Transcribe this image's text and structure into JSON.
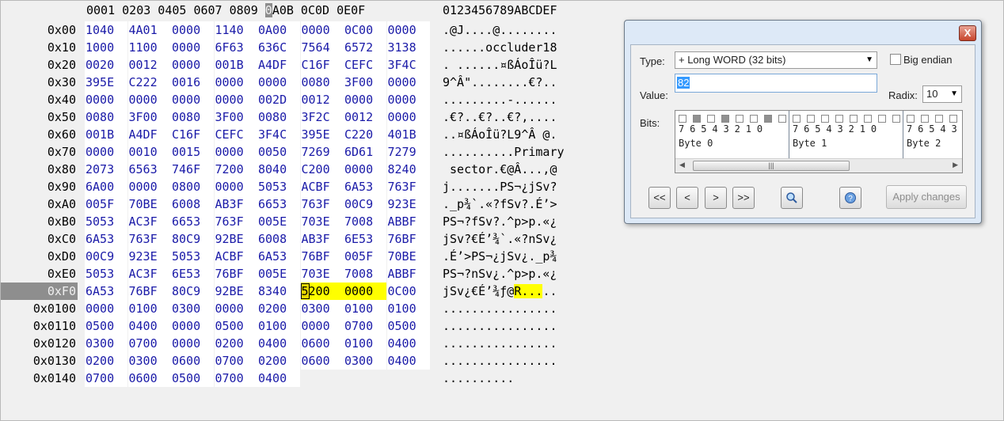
{
  "hex_header": {
    "columns_before": "0001 0203 0405 0607 0809 ",
    "col_highlight_char": "0",
    "columns_after": "A0B 0C0D 0E0F",
    "ascii_header": "0123456789ABCDEF"
  },
  "rows": [
    {
      "offset": "0x00",
      "hex": [
        "1040",
        "4A01",
        "0000",
        "1140",
        "0A00",
        "0000",
        "0C00",
        "0000"
      ],
      "ascii": ".@J....@........"
    },
    {
      "offset": "0x10",
      "hex": [
        "1000",
        "1100",
        "0000",
        "6F63",
        "636C",
        "7564",
        "6572",
        "3138"
      ],
      "ascii": "......occluder18"
    },
    {
      "offset": "0x20",
      "hex": [
        "0020",
        "0012",
        "0000",
        "001B",
        "A4DF",
        "C16F",
        "CEFC",
        "3F4C"
      ],
      "ascii": ". ......¤ßÁoÎü?L"
    },
    {
      "offset": "0x30",
      "hex": [
        "395E",
        "C222",
        "0016",
        "0000",
        "0000",
        "0080",
        "3F00",
        "0000"
      ],
      "ascii": "9^Â\"........€?.."
    },
    {
      "offset": "0x40",
      "hex": [
        "0000",
        "0000",
        "0000",
        "0000",
        "002D",
        "0012",
        "0000",
        "0000"
      ],
      "ascii": ".........-......"
    },
    {
      "offset": "0x50",
      "hex": [
        "0080",
        "3F00",
        "0080",
        "3F00",
        "0080",
        "3F2C",
        "0012",
        "0000"
      ],
      "ascii": ".€?..€?..€?,...."
    },
    {
      "offset": "0x60",
      "hex": [
        "001B",
        "A4DF",
        "C16F",
        "CEFC",
        "3F4C",
        "395E",
        "C220",
        "401B"
      ],
      "ascii": "..¤ßÁoÎü?L9^Â @."
    },
    {
      "offset": "0x70",
      "hex": [
        "0000",
        "0010",
        "0015",
        "0000",
        "0050",
        "7269",
        "6D61",
        "7279"
      ],
      "ascii": "..........Primary"
    },
    {
      "offset": "0x80",
      "hex": [
        "2073",
        "6563",
        "746F",
        "7200",
        "8040",
        "C200",
        "0000",
        "8240"
      ],
      "ascii": " sector.€@Â...‚@"
    },
    {
      "offset": "0x90",
      "hex": [
        "6A00",
        "0000",
        "0800",
        "0000",
        "5053",
        "ACBF",
        "6A53",
        "763F"
      ],
      "ascii": "j.......PS¬¿jSv?"
    },
    {
      "offset": "0xA0",
      "hex": [
        "005F",
        "70BE",
        "6008",
        "AB3F",
        "6653",
        "763F",
        "00C9",
        "923E"
      ],
      "ascii": "._p¾`.«?fSv?.É’>"
    },
    {
      "offset": "0xB0",
      "hex": [
        "5053",
        "AC3F",
        "6653",
        "763F",
        "005E",
        "703E",
        "7008",
        "ABBF"
      ],
      "ascii": "PS¬?fSv?.^p>p.«¿"
    },
    {
      "offset": "0xC0",
      "hex": [
        "6A53",
        "763F",
        "80C9",
        "92BE",
        "6008",
        "AB3F",
        "6E53",
        "76BF"
      ],
      "ascii": "jSv?€É’¾`.«?nSv¿"
    },
    {
      "offset": "0xD0",
      "hex": [
        "00C9",
        "923E",
        "5053",
        "ACBF",
        "6A53",
        "76BF",
        "005F",
        "70BE"
      ],
      "ascii": ".É’>PS¬¿jSv¿._p¾"
    },
    {
      "offset": "0xE0",
      "hex": [
        "5053",
        "AC3F",
        "6E53",
        "76BF",
        "005E",
        "703E",
        "7008",
        "ABBF"
      ],
      "ascii": "PS¬?nSv¿.^p>p.«¿"
    },
    {
      "offset": "0xF0",
      "hex": [
        "6A53",
        "76BF",
        "80C9",
        "92BE",
        "8340",
        "5200",
        "0000",
        "0C00"
      ],
      "ascii_pre": "jSv¿€É’¾ƒ@",
      "ascii_hl": "R...",
      "ascii_post": "..",
      "current": true
    },
    {
      "offset": "0x0100",
      "hex": [
        "0000",
        "0100",
        "0300",
        "0000",
        "0200",
        "0300",
        "0100",
        "0100"
      ],
      "ascii": "................"
    },
    {
      "offset": "0x0110",
      "hex": [
        "0500",
        "0400",
        "0000",
        "0500",
        "0100",
        "0000",
        "0700",
        "0500"
      ],
      "ascii": "................"
    },
    {
      "offset": "0x0120",
      "hex": [
        "0300",
        "0700",
        "0000",
        "0200",
        "0400",
        "0600",
        "0100",
        "0400"
      ],
      "ascii": "................"
    },
    {
      "offset": "0x0130",
      "hex": [
        "0200",
        "0300",
        "0600",
        "0700",
        "0200",
        "0600",
        "0300",
        "0400"
      ],
      "ascii": "................"
    },
    {
      "offset": "0x0140",
      "hex": [
        "0700",
        "0600",
        "0500",
        "0700",
        "0400"
      ],
      "ascii": ".........."
    }
  ],
  "dialog": {
    "close_label": "X",
    "type_label": "Type:",
    "type_value": "+ Long WORD (32 bits)",
    "big_endian_label": "Big endian",
    "value_label": "Value:",
    "value": "82",
    "radix_label": "Radix:",
    "radix_value": "10",
    "bits_label": "Bits:",
    "bit_numbers": "76543210",
    "bytes": [
      {
        "label": "Byte 0",
        "bits_on": [
          1,
          3,
          6
        ]
      },
      {
        "label": "Byte 1",
        "bits_on": []
      },
      {
        "label": "Byte 2",
        "bits_on": []
      }
    ],
    "nav_buttons": [
      "<<",
      "<",
      ">",
      ">>"
    ],
    "apply_label": "Apply changes"
  }
}
